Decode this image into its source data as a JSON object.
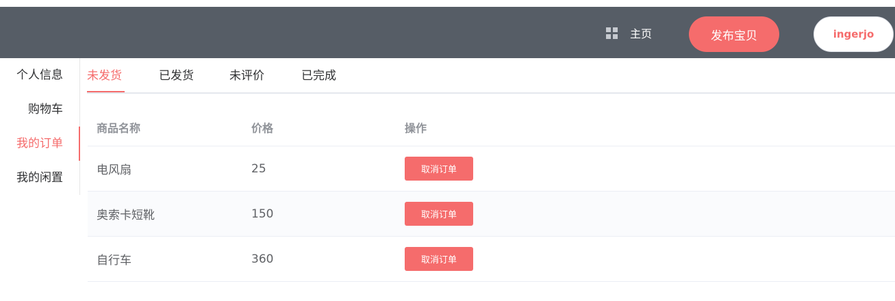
{
  "header": {
    "home_icon": "grid-icon",
    "home_label": "主页",
    "publish_label": "发布宝贝",
    "username": "ingerjo"
  },
  "sidebar": {
    "items": [
      {
        "label": "个人信息",
        "active": false
      },
      {
        "label": "购物车",
        "active": false
      },
      {
        "label": "我的订单",
        "active": true
      },
      {
        "label": "我的闲置",
        "active": false
      }
    ]
  },
  "tabs": [
    {
      "label": "未发货",
      "active": true
    },
    {
      "label": "已发货",
      "active": false
    },
    {
      "label": "未评价",
      "active": false
    },
    {
      "label": "已完成",
      "active": false
    }
  ],
  "table": {
    "columns": [
      "商品名称",
      "价格",
      "操作"
    ],
    "rows": [
      {
        "name": "电风扇",
        "price": "25",
        "action": "取消订单"
      },
      {
        "name": "奥索卡短靴",
        "price": "150",
        "action": "取消订单"
      },
      {
        "name": "自行车",
        "price": "360",
        "action": "取消订单"
      }
    ]
  },
  "colors": {
    "header_bg": "#565d66",
    "accent": "#f56c6c"
  }
}
